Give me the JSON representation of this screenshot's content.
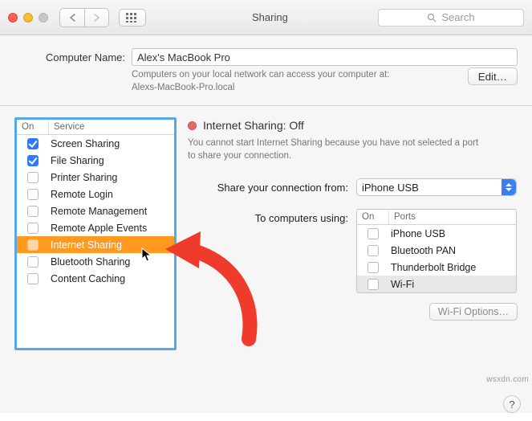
{
  "window": {
    "title": "Sharing",
    "search_placeholder": "Search"
  },
  "computer_name": {
    "label": "Computer Name:",
    "value": "Alex's MacBook Pro",
    "hint_line1": "Computers on your local network can access your computer at:",
    "hint_line2": "Alexs-MacBook-Pro.local",
    "edit_label": "Edit…"
  },
  "service_list": {
    "header_on": "On",
    "header_service": "Service",
    "items": [
      {
        "on": true,
        "name": "Screen Sharing",
        "selected": false
      },
      {
        "on": true,
        "name": "File Sharing",
        "selected": false
      },
      {
        "on": false,
        "name": "Printer Sharing",
        "selected": false
      },
      {
        "on": false,
        "name": "Remote Login",
        "selected": false
      },
      {
        "on": false,
        "name": "Remote Management",
        "selected": false
      },
      {
        "on": false,
        "name": "Remote Apple Events",
        "selected": false
      },
      {
        "on": false,
        "name": "Internet Sharing",
        "selected": true
      },
      {
        "on": false,
        "name": "Bluetooth Sharing",
        "selected": false
      },
      {
        "on": false,
        "name": "Content Caching",
        "selected": false
      }
    ]
  },
  "detail": {
    "status_title": "Internet Sharing: Off",
    "status_desc": "You cannot start Internet Sharing because you have not selected a port to share your connection.",
    "share_from_label": "Share your connection from:",
    "share_from_value": "iPhone USB",
    "to_computers_label": "To computers using:",
    "ports_header_on": "On",
    "ports_header_ports": "Ports",
    "ports": [
      {
        "on": false,
        "name": "iPhone USB",
        "selected": false
      },
      {
        "on": false,
        "name": "Bluetooth PAN",
        "selected": false
      },
      {
        "on": false,
        "name": "Thunderbolt Bridge",
        "selected": false
      },
      {
        "on": false,
        "name": "Wi-Fi",
        "selected": true
      }
    ],
    "wifi_options_label": "Wi-Fi Options…"
  },
  "watermark": "wsxdn.com"
}
